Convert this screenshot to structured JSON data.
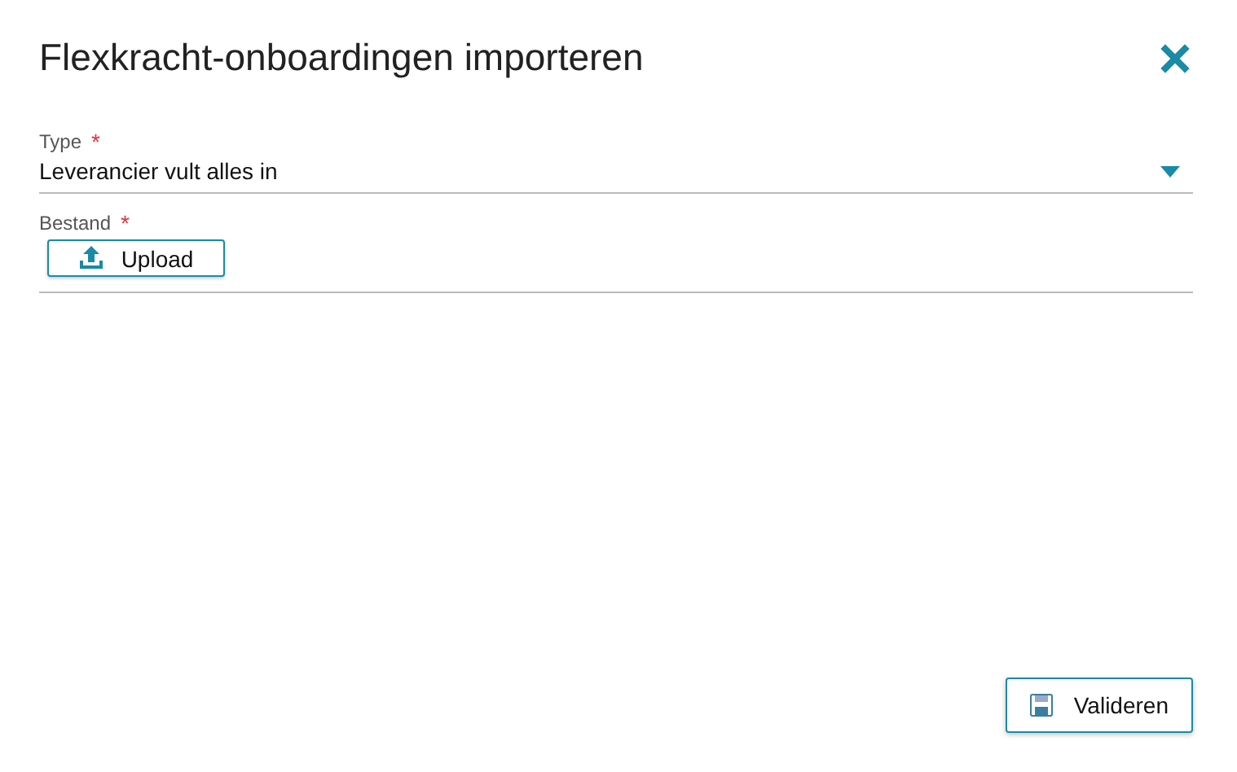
{
  "dialog": {
    "title": "Flexkracht-onboardingen importeren"
  },
  "fields": [
    {
      "kind": "select",
      "label": "Type",
      "required_mark": "*",
      "value": "Leverancier vult alles in"
    },
    {
      "kind": "file",
      "label": "Bestand",
      "required_mark": "*",
      "button": "Upload"
    }
  ],
  "buttons": [
    {
      "label": "Valideren"
    }
  ]
}
